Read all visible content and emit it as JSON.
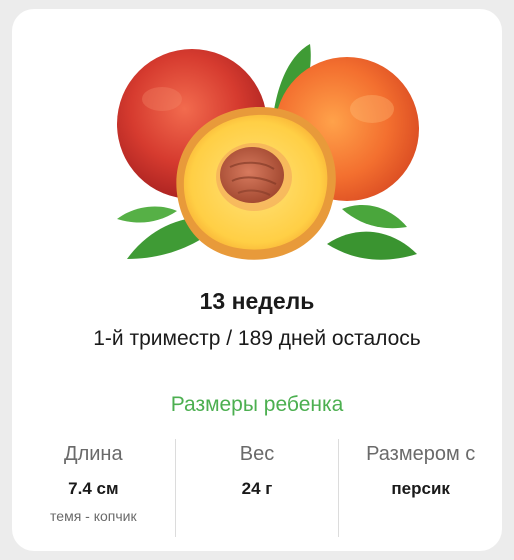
{
  "header": {
    "week_title": "13 недель",
    "trimester_line": "1-й триместр / 189 дней осталось"
  },
  "illustration": {
    "icon": "peach-icon"
  },
  "baby_size": {
    "section_title": "Размеры ребенка",
    "length": {
      "label": "Длина",
      "value": "7.4 см",
      "note": "темя - копчик"
    },
    "weight": {
      "label": "Вес",
      "value": "24 г"
    },
    "comparison": {
      "label": "Размером с",
      "value": "персик"
    }
  },
  "colors": {
    "accent": "#4caf50",
    "background": "#ececec",
    "card": "#ffffff"
  }
}
